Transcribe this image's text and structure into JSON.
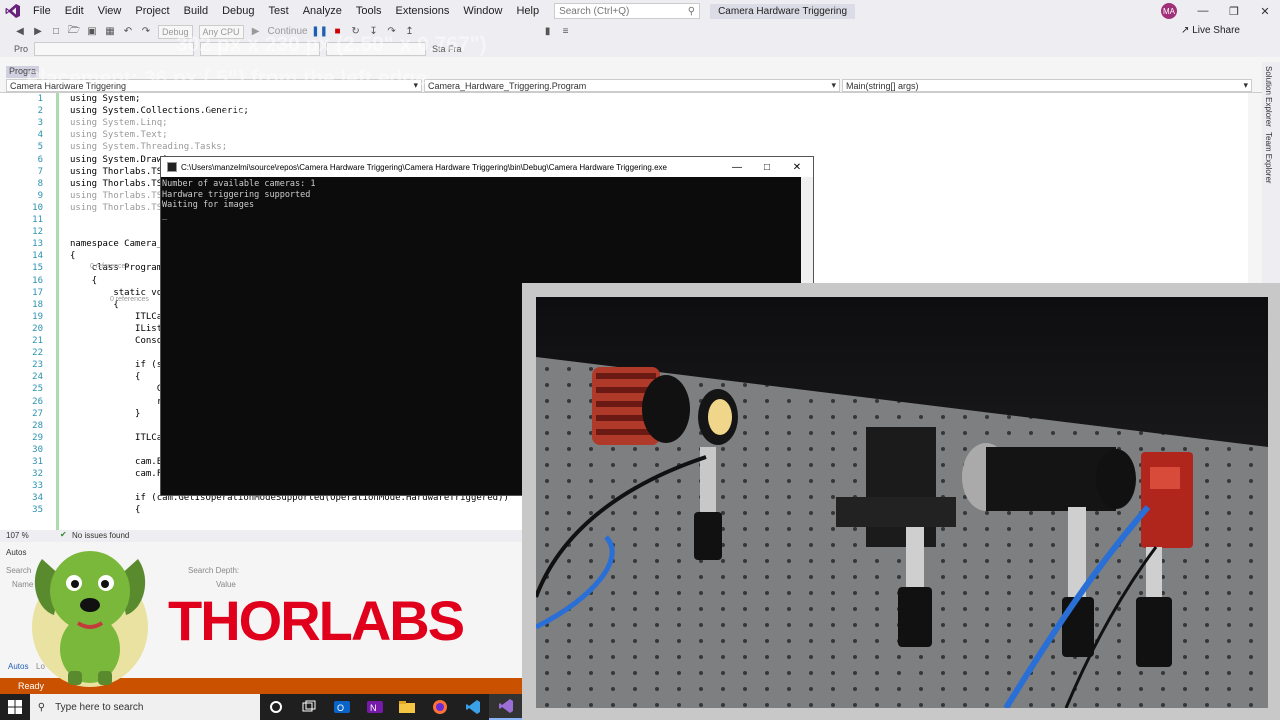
{
  "menubar": {
    "items": [
      "File",
      "Edit",
      "View",
      "Project",
      "Build",
      "Debug",
      "Test",
      "Analyze",
      "Tools",
      "Extensions",
      "Window",
      "Help"
    ],
    "search_placeholder": "Search (Ctrl+Q)",
    "solution_title": "Camera Hardware Triggering",
    "avatar_initials": "MA"
  },
  "toolbar": {
    "config": "Debug",
    "platform": "Any CPU",
    "continue_label": "Continue",
    "live_share": "Live Share"
  },
  "toolbar2": {
    "process_label": "Pro",
    "stack_label": "Sta  Fra"
  },
  "overlay_text": {
    "line1": "302 px x 230 px (2.50\" x 0.767\")",
    "line2": "Placement: 36 px (.5\") from the left edge",
    "line3": "(.75\") from the top edge"
  },
  "editor": {
    "doc_tab": "Progra",
    "nav_project": "Camera Hardware Triggering",
    "nav_class": "Camera_Hardware_Triggering.Program",
    "nav_member": "Main(string[] args)",
    "lines": [
      {
        "n": "1",
        "text": "using System;",
        "dim": false
      },
      {
        "n": "2",
        "text": "using System.Collections.Generic;",
        "dim": false
      },
      {
        "n": "3",
        "text": "using System.Linq;",
        "dim": true
      },
      {
        "n": "4",
        "text": "using System.Text;",
        "dim": true
      },
      {
        "n": "5",
        "text": "using System.Threading.Tasks;",
        "dim": true
      },
      {
        "n": "6",
        "text": "using System.Drawi",
        "dim": false
      },
      {
        "n": "7",
        "text": "using Thorlabs.TSI",
        "dim": false
      },
      {
        "n": "8",
        "text": "using Thorlabs.TSI",
        "dim": false
      },
      {
        "n": "9",
        "text": "using Thorlabs.TS",
        "dim": true
      },
      {
        "n": "10",
        "text": "using Thorlabs.TS",
        "dim": true
      },
      {
        "n": "11",
        "text": "",
        "dim": false
      },
      {
        "n": "12",
        "text": "",
        "dim": false
      },
      {
        "n": "13",
        "text": "namespace Camera_H",
        "dim": false
      },
      {
        "n": "14",
        "text": "{",
        "dim": false
      },
      {
        "n": "15",
        "text": "    class Program",
        "dim": false
      },
      {
        "n": "16",
        "text": "    {",
        "dim": false
      },
      {
        "n": "17",
        "text": "        static voi",
        "dim": false
      },
      {
        "n": "18",
        "text": "        {",
        "dim": false
      },
      {
        "n": "19",
        "text": "            ITLCam",
        "dim": false
      },
      {
        "n": "20",
        "text": "            IList<",
        "dim": false
      },
      {
        "n": "21",
        "text": "            Consol",
        "dim": false
      },
      {
        "n": "22",
        "text": "",
        "dim": false
      },
      {
        "n": "23",
        "text": "            if (se",
        "dim": false
      },
      {
        "n": "24",
        "text": "            {",
        "dim": false
      },
      {
        "n": "25",
        "text": "                Co",
        "dim": false
      },
      {
        "n": "26",
        "text": "                re",
        "dim": false
      },
      {
        "n": "27",
        "text": "            }",
        "dim": false
      },
      {
        "n": "28",
        "text": "",
        "dim": false
      },
      {
        "n": "29",
        "text": "            ITLCam",
        "dim": false
      },
      {
        "n": "30",
        "text": "",
        "dim": false
      },
      {
        "n": "31",
        "text": "            cam.Ex",
        "dim": false
      },
      {
        "n": "32",
        "text": "            cam.Fr",
        "dim": false
      },
      {
        "n": "33",
        "text": "",
        "dim": false
      },
      {
        "n": "34",
        "text": "            if (cam.GetIsOperationModeSupported(OperationMode.HardwareTriggered))",
        "dim": false
      },
      {
        "n": "35",
        "text": "            {",
        "dim": false
      }
    ],
    "references_label": "0 references",
    "zoom": "107 %",
    "issues": "No issues found"
  },
  "side_tabs": [
    "Solution Explorer",
    "Team Explorer"
  ],
  "autos": {
    "title": "Autos",
    "search_label": "Search",
    "search_depth_label": "Search Depth:",
    "col_name": "Name",
    "col_value": "Value",
    "bottom_tabs": [
      "Autos",
      "Lo"
    ]
  },
  "status": {
    "ready": "Ready"
  },
  "console": {
    "title": "C:\\Users\\manzelmi\\source\\repos\\Camera Hardware Triggering\\Camera Hardware Triggering\\bin\\Debug\\Camera Hardware Triggering.exe",
    "output": "Number of available cameras: 1\nHardware triggering supported\nWaiting for images\n_"
  },
  "logo": {
    "brand_text": "THORLABS"
  },
  "taskbar": {
    "search_placeholder": "Type here to search",
    "apps": [
      "cortana-icon",
      "task-view-icon",
      "outlook-icon",
      "onenote-icon",
      "file-explorer-icon",
      "firefox-icon",
      "vs-code-icon",
      "visual-studio-icon"
    ]
  },
  "colors": {
    "vs_purple": "#68217a",
    "status_orange": "#ca5100",
    "thorlabs_red": "#e0001b",
    "console_bg": "#0c0c0c"
  }
}
